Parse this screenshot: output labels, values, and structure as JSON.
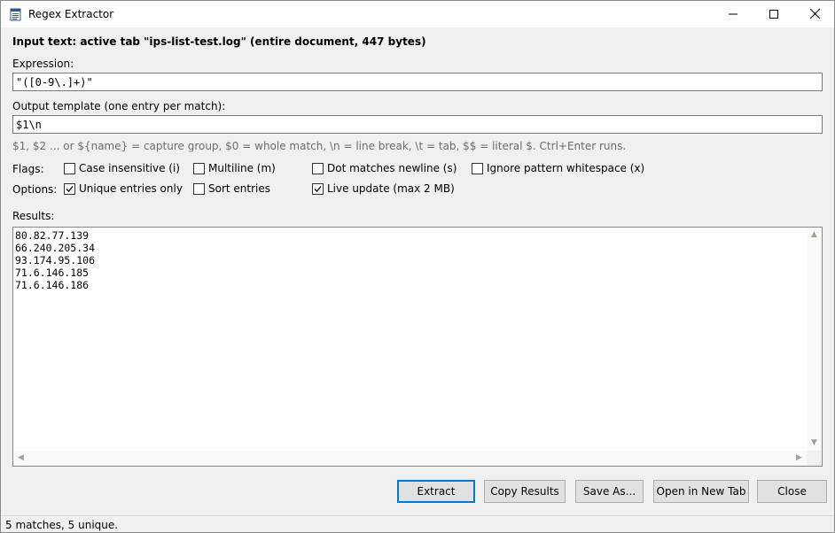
{
  "window": {
    "title": "Regex Extractor",
    "app_icon": "notepad-document-icon",
    "controls": [
      "minimize-icon",
      "maximize-icon",
      "close-icon"
    ]
  },
  "input_info": "Input text: active tab \"ips-list-test.log\" (entire document, 447 bytes)",
  "expression": {
    "label": "Expression:",
    "value": "\"([0-9\\.]+)\""
  },
  "output_template": {
    "label": "Output template (one entry per match):",
    "value": "$1\\n",
    "hint": "$1, $2 ... or ${name} = capture group,  $0 = whole match,  \\n = line break,  \\t = tab,  $$ = literal $.  Ctrl+Enter runs."
  },
  "flags": {
    "label": "Flags:",
    "items": [
      {
        "label": "Case insensitive (i)",
        "checked": false
      },
      {
        "label": "Multiline (m)",
        "checked": false
      },
      {
        "label": "Dot matches newline (s)",
        "checked": false
      },
      {
        "label": "Ignore pattern whitespace (x)",
        "checked": false
      }
    ]
  },
  "options": {
    "label": "Options:",
    "items": [
      {
        "label": "Unique entries only",
        "checked": true
      },
      {
        "label": "Sort entries",
        "checked": false
      },
      {
        "label": "Live update (max 2 MB)",
        "checked": true
      }
    ]
  },
  "results": {
    "label": "Results:",
    "lines": [
      "80.82.77.139",
      "66.240.205.34",
      "93.174.95.106",
      "71.6.146.185",
      "71.6.146.186"
    ]
  },
  "buttons": {
    "extract": "Extract",
    "copy": "Copy Results",
    "save": "Save As...",
    "open_tab": "Open in New Tab",
    "close": "Close"
  },
  "status": "5 matches, 5 unique."
}
